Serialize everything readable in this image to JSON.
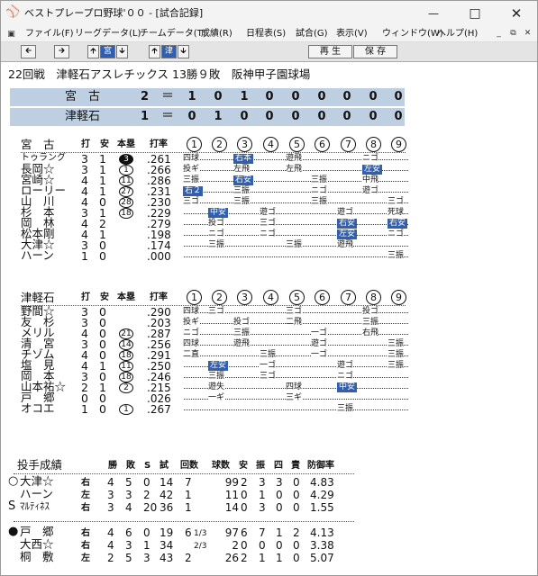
{
  "window": {
    "title": "ベストプレープロ野球'００ - [試合記録]"
  },
  "menu": [
    "ファイル(F)",
    "リーグデータ(L)",
    "チームデータ(T)",
    "成績(R)",
    "日程表(S)",
    "試合(G)",
    "表示(V)",
    "ウィンドウ(W)",
    "ヘルプ(H)"
  ],
  "toolbar": {
    "home_label": "宮",
    "away_label": "津",
    "play_label": "再 生",
    "save_label": "保 存"
  },
  "game_info": "22回戦　津軽石アスレチックス 13勝９敗　阪神甲子園球場",
  "linescore": [
    {
      "team": "宮　古",
      "runs": "2",
      "innings": [
        "1",
        "0",
        "1",
        "0",
        "0",
        "0",
        "0",
        "0",
        "0"
      ]
    },
    {
      "team": "津軽石",
      "runs": "1",
      "innings": [
        "0",
        "1",
        "0",
        "0",
        "0",
        "0",
        "0",
        "0",
        "0"
      ]
    }
  ],
  "batting_headers": {
    "ab": "打",
    "h": "安",
    "hr": "本塁",
    "avg": "打率"
  },
  "inning_labels": [
    "1",
    "2",
    "3",
    "4",
    "5",
    "6",
    "7",
    "8",
    "9"
  ],
  "teams": [
    {
      "name": "宮　古",
      "players": [
        {
          "name": "トゥラング",
          "ab": "3",
          "h": "1",
          "hr": "3",
          "hr_fill": true,
          "avg": ".261",
          "abs": [
            {
              "i": 1,
              "r": "四球"
            },
            {
              "i": 3,
              "r": "右本",
              "hl": true
            },
            {
              "i": 5,
              "r": "遊飛"
            },
            {
              "i": 8,
              "r": "ニゴ"
            }
          ]
        },
        {
          "name": "長岡☆",
          "ab": "3",
          "h": "1",
          "hr": "1",
          "avg": ".266",
          "abs": [
            {
              "i": 1,
              "r": "投ギ"
            },
            {
              "i": 3,
              "r": "左飛"
            },
            {
              "i": 5,
              "r": "左飛"
            },
            {
              "i": 8,
              "r": "左安",
              "hl": true
            }
          ]
        },
        {
          "name": "宮崎☆",
          "ab": "4",
          "h": "1",
          "hr": "11",
          "avg": ".286",
          "abs": [
            {
              "i": 1,
              "r": "三振"
            },
            {
              "i": 3,
              "r": "右安",
              "hl": true
            },
            {
              "i": 6,
              "r": "三振"
            },
            {
              "i": 8,
              "r": "中飛"
            }
          ]
        },
        {
          "name": "ローリー",
          "ab": "4",
          "h": "1",
          "hr": "27",
          "avg": ".231",
          "abs": [
            {
              "i": 1,
              "r": "右２",
              "hl": true
            },
            {
              "i": 3,
              "r": "三振"
            },
            {
              "i": 6,
              "r": "ニゴ"
            },
            {
              "i": 8,
              "r": "遊ゴ"
            }
          ]
        },
        {
          "name": "山　川",
          "ab": "4",
          "h": "0",
          "hr": "28",
          "avg": ".230",
          "abs": [
            {
              "i": 1,
              "r": "三ゴ"
            },
            {
              "i": 3,
              "r": "三振"
            },
            {
              "i": 6,
              "r": "三振"
            },
            {
              "i": 9,
              "r": "三ゴ"
            }
          ]
        },
        {
          "name": "杉　本",
          "ab": "3",
          "h": "1",
          "hr": "18",
          "avg": ".229",
          "abs": [
            {
              "i": 2,
              "r": "中安",
              "hl": true
            },
            {
              "i": 4,
              "r": "遊ゴ"
            },
            {
              "i": 7,
              "r": "遊ゴ"
            },
            {
              "i": 9,
              "r": "死球"
            }
          ]
        },
        {
          "name": "岡　林",
          "ab": "4",
          "h": "2",
          "hr": "",
          "avg": ".279",
          "abs": [
            {
              "i": 2,
              "r": "投ゴ"
            },
            {
              "i": 4,
              "r": "三ゴ"
            },
            {
              "i": 7,
              "r": "右安",
              "hl": true
            },
            {
              "i": 9,
              "r": "右安",
              "hl": true
            }
          ]
        },
        {
          "name": "松本剛",
          "ab": "4",
          "h": "1",
          "hr": "",
          "avg": ".198",
          "abs": [
            {
              "i": 2,
              "r": "ニゴ"
            },
            {
              "i": 4,
              "r": "ニゴ"
            },
            {
              "i": 7,
              "r": "左安",
              "hl": true
            },
            {
              "i": 9,
              "r": "ニゴ"
            }
          ]
        },
        {
          "name": "大津☆",
          "ab": "3",
          "h": "0",
          "hr": "",
          "avg": ".174",
          "abs": [
            {
              "i": 2,
              "r": "三振"
            },
            {
              "i": 5,
              "r": "三振"
            },
            {
              "i": 7,
              "r": "遊飛"
            }
          ]
        },
        {
          "name": "ハーン",
          "ab": "1",
          "h": "0",
          "hr": "",
          "avg": ".000",
          "abs": [
            {
              "i": 9,
              "r": "三振"
            }
          ]
        }
      ]
    },
    {
      "name": "津軽石",
      "players": [
        {
          "name": "野間☆",
          "ab": "3",
          "h": "0",
          "hr": "",
          "avg": ".290",
          "abs": [
            {
              "i": 1,
              "r": "四球"
            },
            {
              "i": 2,
              "r": "三ゴ"
            },
            {
              "i": 5,
              "r": "三ゴ"
            },
            {
              "i": 8,
              "r": "投ゴ"
            }
          ]
        },
        {
          "name": "友　杉",
          "ab": "3",
          "h": "0",
          "hr": "",
          "avg": ".203",
          "abs": [
            {
              "i": 1,
              "r": "投ギ"
            },
            {
              "i": 3,
              "r": "投ゴ"
            },
            {
              "i": 5,
              "r": "二飛"
            },
            {
              "i": 8,
              "r": "三振"
            }
          ]
        },
        {
          "name": "メリル",
          "ab": "4",
          "h": "0",
          "hr": "21",
          "avg": ".287",
          "abs": [
            {
              "i": 1,
              "r": "ニゴ"
            },
            {
              "i": 3,
              "r": "三振"
            },
            {
              "i": 6,
              "r": "一ゴ"
            },
            {
              "i": 8,
              "r": "右飛"
            }
          ]
        },
        {
          "name": "清　宮",
          "ab": "3",
          "h": "0",
          "hr": "14",
          "avg": ".256",
          "abs": [
            {
              "i": 1,
              "r": "四球"
            },
            {
              "i": 3,
              "r": "遊飛"
            },
            {
              "i": 6,
              "r": "遊ゴ"
            },
            {
              "i": 9,
              "r": "三振"
            }
          ]
        },
        {
          "name": "チゾム",
          "ab": "4",
          "h": "0",
          "hr": "18",
          "avg": ".291",
          "abs": [
            {
              "i": 1,
              "r": "二直"
            },
            {
              "i": 4,
              "r": "三振"
            },
            {
              "i": 6,
              "r": "一ゴ"
            },
            {
              "i": 9,
              "r": "三振"
            }
          ]
        },
        {
          "name": "塩　見",
          "ab": "4",
          "h": "1",
          "hr": "11",
          "avg": ".250",
          "abs": [
            {
              "i": 2,
              "r": "左安",
              "hl": true
            },
            {
              "i": 4,
              "r": "一ゴ"
            },
            {
              "i": 7,
              "r": "遊ゴ"
            },
            {
              "i": 9,
              "r": "三振"
            }
          ]
        },
        {
          "name": "岡　本",
          "ab": "3",
          "h": "0",
          "hr": "18",
          "avg": ".246",
          "abs": [
            {
              "i": 2,
              "r": "三振"
            },
            {
              "i": 4,
              "r": "三ゴ"
            },
            {
              "i": 7,
              "r": "ニゴ"
            }
          ]
        },
        {
          "name": "山本祐☆",
          "ab": "2",
          "h": "1",
          "hr": "2",
          "avg": ".215",
          "abs": [
            {
              "i": 2,
              "r": "遊失"
            },
            {
              "i": 5,
              "r": "四球"
            },
            {
              "i": 7,
              "r": "中安",
              "hl": true
            }
          ]
        },
        {
          "name": "戸　郷",
          "ab": "0",
          "h": "0",
          "hr": "",
          "avg": ".026",
          "abs": [
            {
              "i": 2,
              "r": "一ギ"
            },
            {
              "i": 5,
              "r": "三ギ"
            }
          ]
        },
        {
          "name": "オコエ",
          "ab": "1",
          "h": "0",
          "hr": "1",
          "avg": ".267",
          "abs": [
            {
              "i": 7,
              "r": "三振"
            }
          ]
        }
      ]
    }
  ],
  "pitching": {
    "title": "投手成績",
    "headers": [
      "勝",
      "敗",
      "S",
      "試",
      "回数",
      "球数",
      "安",
      "振",
      "四",
      "責",
      "防御率"
    ],
    "groups": [
      [
        {
          "mark": "○",
          "name": "大津☆",
          "hand": "右",
          "w": "4",
          "l": "5",
          "s": "0",
          "g": "14",
          "ip": "7",
          "ipf": "",
          "np": "99",
          "h": "2",
          "k": "3",
          "bb": "3",
          "er": "0",
          "era": "4.83"
        },
        {
          "mark": "",
          "name": "ハーン",
          "hand": "左",
          "w": "3",
          "l": "3",
          "s": "2",
          "g": "42",
          "ip": "1",
          "ipf": "",
          "np": "11",
          "h": "0",
          "k": "1",
          "bb": "0",
          "er": "0",
          "era": "4.29"
        },
        {
          "mark": "S",
          "name": "ﾏﾙﾃｨﾈｽ",
          "hand": "右",
          "w": "3",
          "l": "4",
          "s": "20",
          "g": "36",
          "ip": "1",
          "ipf": "",
          "np": "14",
          "h": "0",
          "k": "3",
          "bb": "0",
          "er": "0",
          "era": "1.55"
        }
      ],
      [
        {
          "mark": "●",
          "name": "戸　郷",
          "hand": "右",
          "w": "4",
          "l": "6",
          "s": "0",
          "g": "19",
          "ip": "6",
          "ipf": "1/3",
          "np": "97",
          "h": "6",
          "k": "7",
          "bb": "1",
          "er": "2",
          "era": "4.13"
        },
        {
          "mark": "",
          "name": "大西☆",
          "hand": "右",
          "w": "4",
          "l": "3",
          "s": "1",
          "g": "34",
          "ip": "",
          "ipf": "2/3",
          "np": "2",
          "h": "0",
          "k": "0",
          "bb": "0",
          "er": "0",
          "era": "3.38"
        },
        {
          "mark": "",
          "name": "桐　敷",
          "hand": "左",
          "w": "2",
          "l": "5",
          "s": "3",
          "g": "43",
          "ip": "2",
          "ipf": "",
          "np": "26",
          "h": "2",
          "k": "1",
          "bb": "1",
          "er": "0",
          "era": "5.07"
        }
      ]
    ]
  }
}
